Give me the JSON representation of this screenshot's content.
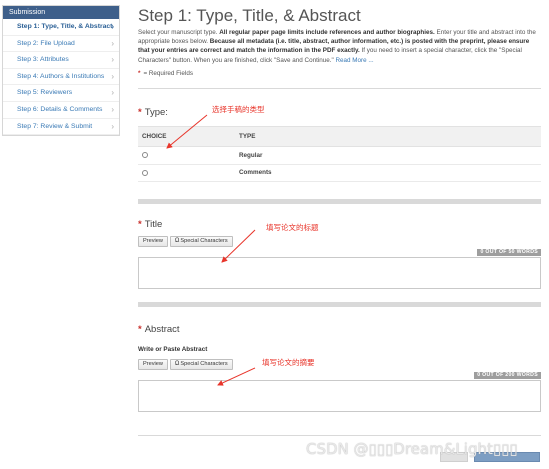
{
  "sidebar": {
    "header": "Submission",
    "items": [
      {
        "label": "Step 1: Type, Title, & Abstract",
        "active": true
      },
      {
        "label": "Step 2: File Upload",
        "active": false
      },
      {
        "label": "Step 3: Attributes",
        "active": false
      },
      {
        "label": "Step 4: Authors & Institutions",
        "active": false
      },
      {
        "label": "Step 5: Reviewers",
        "active": false
      },
      {
        "label": "Step 6: Details & Comments",
        "active": false
      },
      {
        "label": "Step 7: Review & Submit",
        "active": false
      }
    ],
    "chevron": "›"
  },
  "main": {
    "title": "Step 1: Type, Title, & Abstract",
    "intro": {
      "part1": "Select your manuscript type. ",
      "bold1": "All regular paper page limits include references and author biographies.",
      "part2": " Enter your title and abstract into the appropriate boxes below. ",
      "bold2": "Because all metadata (i.e. title, abstract, author information, etc.) is posted with the preprint, please ensure that your entries are correct and match the information in the PDF exactly.",
      "part3": " If you need to insert a special character, click the \"Special Characters\" button. When you are finished, click \"Save and Continue.\" ",
      "read_more": "Read More ..."
    },
    "required_note": "= Required Fields",
    "required_star": "*",
    "type_section": {
      "label": "Type:",
      "col_choice": "CHOICE",
      "col_type": "TYPE",
      "options": [
        "Regular",
        "Comments"
      ]
    },
    "title_section": {
      "label": "Title",
      "preview": "Preview",
      "special_chars": "Special Characters",
      "special_icon": "Ω",
      "word_count": "0 OUT OF 50 WORDS"
    },
    "abstract_section": {
      "label": "Abstract",
      "sub_label": "Write or Paste Abstract",
      "preview": "Preview",
      "special_chars": "Special Characters",
      "special_icon": "Ω",
      "word_count": "0 OUT OF 200 WORDS"
    }
  },
  "annotations": {
    "type": "选择手稿的类型",
    "title": "填写论文的标题",
    "abstract": "填写论文的摘要"
  },
  "watermark": "CSDN @▯▯▯Dream&Light▯▯▯",
  "colors": {
    "sidebar_header": "#3e5f8a",
    "link": "#3a7ab5",
    "required_star": "#c9302c",
    "annotation": "#e8352b",
    "word_count_badge": "#9e9e9e"
  }
}
